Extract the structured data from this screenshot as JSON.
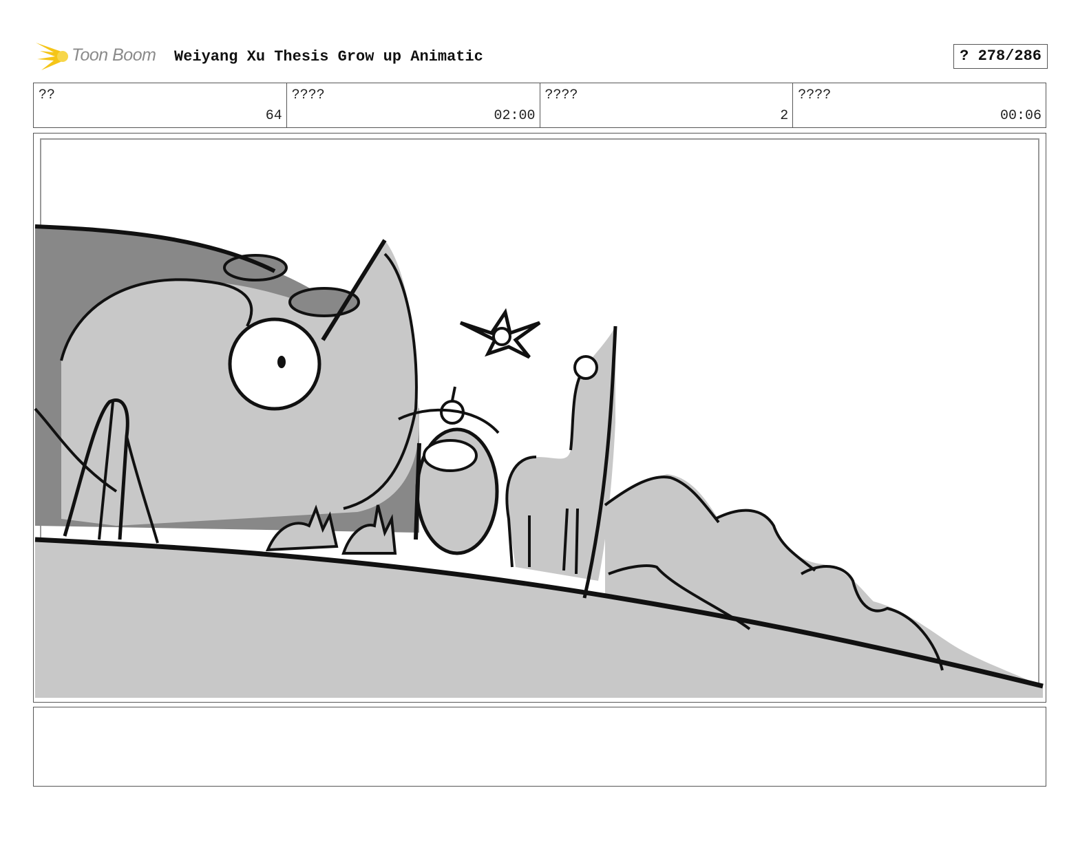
{
  "header": {
    "logo_text": "Toon Boom",
    "project_title": "Weiyang Xu Thesis Grow up Animatic",
    "page_counter": "? 278/286"
  },
  "info": [
    {
      "label": "??",
      "value": "64"
    },
    {
      "label": "????",
      "value": "02:00"
    },
    {
      "label": "????",
      "value": "2"
    },
    {
      "label": "????",
      "value": "00:06"
    }
  ],
  "panel": {
    "icon": "storyboard-sketch",
    "colors": {
      "fill_light": "#c8c8c8",
      "fill_dark": "#888888",
      "line": "#111111"
    }
  },
  "notes": {
    "text": ""
  },
  "colors": {
    "logo_star": "#f5c518",
    "logo_text": "#8a8a8a",
    "border": "#555555"
  }
}
